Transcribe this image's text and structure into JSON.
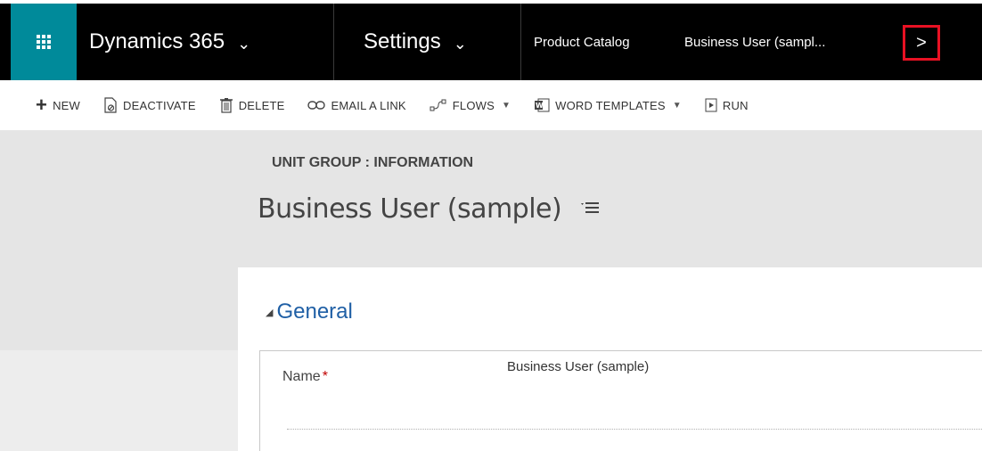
{
  "nav": {
    "app_name": "Dynamics 365",
    "area_name": "Settings",
    "breadcrumb_1": "Product Catalog",
    "breadcrumb_2": "Business User (sampl...",
    "chevron_down": "⌄",
    "next_icon": ">"
  },
  "commands": [
    {
      "label": "NEW",
      "icon": "+"
    },
    {
      "label": "DEACTIVATE",
      "icon": "deactivate-icon"
    },
    {
      "label": "DELETE",
      "icon": "trash-icon"
    },
    {
      "label": "EMAIL A LINK",
      "icon": "link-icon"
    },
    {
      "label": "FLOWS",
      "icon": "flows-icon"
    },
    {
      "label": "WORD TEMPLATES",
      "icon": "word-icon"
    },
    {
      "label": "RUN",
      "icon": "run-icon"
    }
  ],
  "header": {
    "entity_label": "UNIT GROUP : INFORMATION",
    "record_title": "Business User (sample)"
  },
  "form": {
    "section_title": "General",
    "fields": [
      {
        "label": "Name",
        "required_marker": "*",
        "value": "Business User (sample)"
      }
    ]
  },
  "colors": {
    "waffle_bg": "#008a9a",
    "nav_bg": "#000000",
    "highlight_border": "#e81123",
    "section_title": "#1f5fa5"
  }
}
